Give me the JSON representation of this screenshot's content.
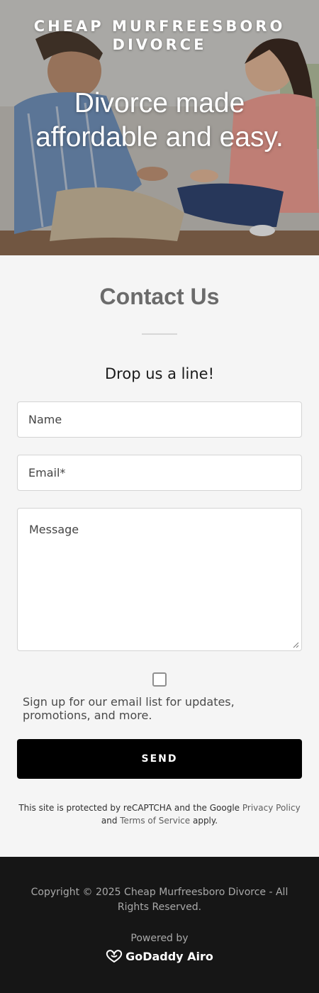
{
  "hero": {
    "brand": "CHEAP MURFREESBORO DIVORCE",
    "tagline": "Divorce made affordable and easy."
  },
  "contact": {
    "title": "Contact Us",
    "subtitle": "Drop us a line!",
    "fields": {
      "name_placeholder": "Name",
      "email_placeholder": "Email*",
      "message_placeholder": "Message"
    },
    "signup_label": "Sign up for our email list for updates, promotions, and more.",
    "signup_checked": false,
    "send_label": "SEND",
    "recaptcha": {
      "prefix": "This site is protected by reCAPTCHA and the Google ",
      "privacy_link": "Privacy Policy",
      "and": " and ",
      "terms_link": "Terms of Service",
      "suffix": " apply."
    }
  },
  "footer": {
    "copyright": "Copyright © 2025 Cheap Murfreesboro Divorce - All Rights Reserved.",
    "powered_by": "Powered by",
    "logo_text": "GoDaddy Airo"
  },
  "colors": {
    "send_button": "#000000",
    "footer_bg": "#161616",
    "page_bg": "#f5f5f5"
  }
}
